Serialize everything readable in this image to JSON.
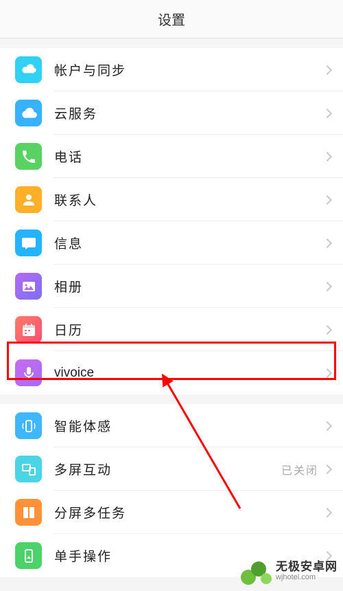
{
  "header": {
    "title": "设置"
  },
  "sections": [
    {
      "rows": [
        {
          "id": "account-sync",
          "label": "帐户与同步",
          "icon": "cloud-sync",
          "bg": "#30d1f2"
        },
        {
          "id": "cloud",
          "label": "云服务",
          "icon": "cloud",
          "bg": "#36b2ff"
        },
        {
          "id": "phone",
          "label": "电话",
          "icon": "phone",
          "bg": "#58d363"
        },
        {
          "id": "contacts",
          "label": "联系人",
          "icon": "person",
          "bg": "#ffb028"
        },
        {
          "id": "messages",
          "label": "信息",
          "icon": "chat",
          "bg": "#24b4ff"
        },
        {
          "id": "gallery",
          "label": "相册",
          "icon": "image",
          "bg_grad": [
            "#b66af0",
            "#7a70f4"
          ]
        },
        {
          "id": "calendar",
          "label": "日历",
          "icon": "calendar",
          "bg_grad": [
            "#ff7a6a",
            "#ff4f6f"
          ]
        },
        {
          "id": "vivoice",
          "label": "vivoice",
          "icon": "mic",
          "bg_grad": [
            "#c96bf2",
            "#a56bf5"
          ],
          "highlighted": true,
          "no_spacing": true
        }
      ]
    },
    {
      "rows": [
        {
          "id": "smart-motion",
          "label": "智能体感",
          "icon": "device-motion",
          "bg": "#3fb7ff"
        },
        {
          "id": "multiscreen",
          "label": "多屏互动",
          "icon": "multiscreen",
          "bg": "#4bd3e6",
          "status": "已关闭"
        },
        {
          "id": "splitscreen",
          "label": "分屏多任务",
          "icon": "split",
          "bg": "#ff9238"
        },
        {
          "id": "onehand",
          "label": "单手操作",
          "icon": "hand",
          "bg": "#4bd36a"
        }
      ]
    }
  ],
  "watermark": {
    "line1": "无极安卓网",
    "line2": "wjhotel.com"
  }
}
